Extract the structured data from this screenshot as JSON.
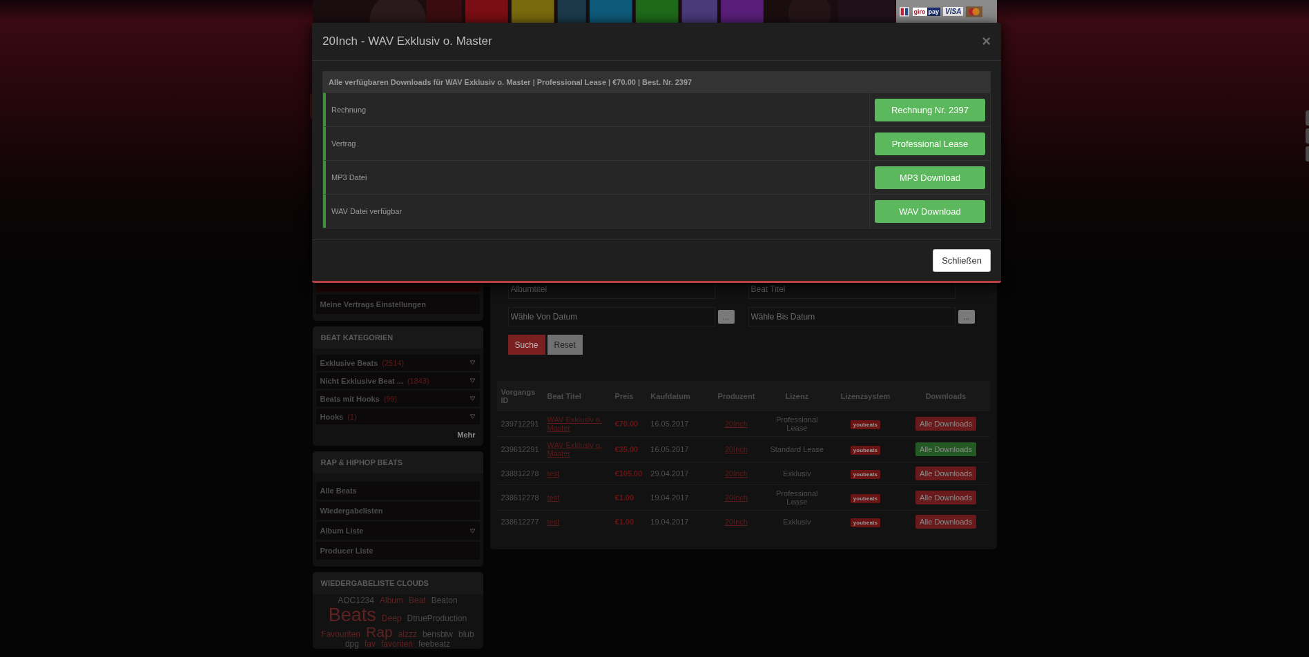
{
  "header": {
    "payment_labels": [
      "giro",
      "pay",
      "VISA"
    ]
  },
  "sidebar": {
    "account_items": [
      {
        "label": "Meine Vertrags Einstellungen"
      }
    ],
    "categories": {
      "title": "BEAT KATEGORIEN",
      "more": "Mehr",
      "items": [
        {
          "label": "Exklusive Beats",
          "count": "(2514)"
        },
        {
          "label": "Nicht Exklusive Beat ...",
          "count": "(1843)"
        },
        {
          "label": "Beats mit Hooks",
          "count": "(99)"
        },
        {
          "label": "Hooks",
          "count": "(1)"
        }
      ]
    },
    "rap": {
      "title": "RAP & HIPHOP BEATS",
      "items": [
        {
          "label": "Alle Beats",
          "expandable": false
        },
        {
          "label": "Wiedergabelisten",
          "expandable": false
        },
        {
          "label": "Album Liste",
          "expandable": true
        },
        {
          "label": "Producer Liste",
          "expandable": false
        }
      ]
    },
    "clouds": {
      "title": "WIEDERGABELISTE CLOUDS",
      "tags": [
        {
          "text": "AOC1234",
          "kind": "small",
          "color": "#4a4a4a"
        },
        {
          "text": "Album",
          "kind": "small",
          "color": "#5e2222"
        },
        {
          "text": "Beat",
          "kind": "small",
          "color": "#5e2222"
        },
        {
          "text": "Beaton",
          "kind": "small",
          "color": "#4a4a4a"
        },
        {
          "text": "Beats",
          "kind": "large",
          "color": "#5e2222"
        },
        {
          "text": "Deep",
          "kind": "small",
          "color": "#5e2222"
        },
        {
          "text": "DtrueProduction",
          "kind": "small",
          "color": "#4a4a4a"
        },
        {
          "text": "Favouriten",
          "kind": "small",
          "color": "#5e2222"
        },
        {
          "text": "Rap",
          "kind": "medium",
          "color": "#5e2222"
        },
        {
          "text": "alzzz",
          "kind": "small",
          "color": "#5e2222"
        },
        {
          "text": "bensbiw",
          "kind": "small",
          "color": "#4a4a4a"
        },
        {
          "text": "blub",
          "kind": "small",
          "color": "#4a4a4a"
        },
        {
          "text": "dpg",
          "kind": "small",
          "color": "#4a4a4a"
        },
        {
          "text": "fav",
          "kind": "small",
          "color": "#5e2222"
        },
        {
          "text": "favoriten",
          "kind": "small",
          "color": "#5e2222"
        },
        {
          "text": "feebeatz",
          "kind": "small",
          "color": "#4a4a4a"
        }
      ]
    }
  },
  "filters": {
    "fields": [
      {
        "placeholder": "Albumtitel"
      },
      {
        "placeholder": "Beat Titel"
      }
    ],
    "date_fields": [
      {
        "placeholder": "Wähle Von Datum",
        "button": "..."
      },
      {
        "placeholder": "Wähle Bis Datum",
        "button": "..."
      }
    ],
    "search_button": "Suche",
    "reset_button": "Reset"
  },
  "table": {
    "columns": [
      "Vorgangs ID",
      "Beat Titel",
      "Preis",
      "Kaufdatum",
      "Produzent",
      "Lizenz",
      "Lizenzsystem",
      "Downloads"
    ],
    "rows": [
      {
        "id": "239712291",
        "title": "WAV Exklusiv o. Master",
        "price": "€70.00",
        "date": "16.05.2017",
        "producer": "20Inch",
        "license": "Professional Lease",
        "system": "youbeats",
        "download": "Alle Downloads",
        "active": false
      },
      {
        "id": "239612291",
        "title": "WAV Exklusiv o. Master",
        "price": "€35.00",
        "date": "16.05.2017",
        "producer": "20Inch",
        "license": "Standard Lease",
        "system": "youbeats",
        "download": "Alle Downloads",
        "active": true
      },
      {
        "id": "238812278",
        "title": "test",
        "price": "€105.00",
        "date": "29.04.2017",
        "producer": "20Inch",
        "license": "Exklusiv",
        "system": "youbeats",
        "download": "Alle Downloads",
        "active": false
      },
      {
        "id": "238612278",
        "title": "test",
        "price": "€1.00",
        "date": "19.04.2017",
        "producer": "20Inch",
        "license": "Professional Lease",
        "system": "youbeats",
        "download": "Alle Downloads",
        "active": false
      },
      {
        "id": "238612277",
        "title": "test",
        "price": "€1.00",
        "date": "19.04.2017",
        "producer": "20Inch",
        "license": "Exklusiv",
        "system": "youbeats",
        "download": "Alle Downloads",
        "active": false
      }
    ]
  },
  "modal": {
    "title": "20Inch - WAV Exklusiv o. Master",
    "close": "×",
    "header": "Alle verfügbaren Downloads für WAV Exklusiv o. Master | Professional Lease | €70.00 | Best. Nr. 2397",
    "rows": [
      {
        "label": "Rechnung",
        "button": "Rechnung Nr. 2397"
      },
      {
        "label": "Vertrag",
        "button": "Professional Lease"
      },
      {
        "label": "MP3 Datei",
        "button": "MP3 Download"
      },
      {
        "label": "WAV Datei verfügbar",
        "button": "WAV Download"
      }
    ],
    "footer_button": "Schließen"
  }
}
